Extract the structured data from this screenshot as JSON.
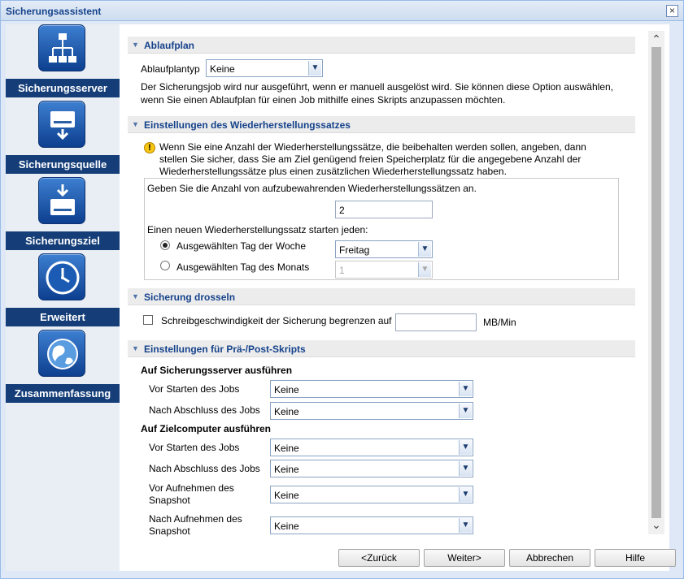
{
  "window": {
    "title": "Sicherungsassistent"
  },
  "nav": [
    {
      "label": "Sicherungsserver",
      "icon": "network-server-icon"
    },
    {
      "label": "Sicherungsquelle",
      "icon": "drive-download-icon"
    },
    {
      "label": "Sicherungsziel",
      "icon": "drive-target-icon"
    },
    {
      "label": "Erweitert",
      "icon": "clock-icon"
    },
    {
      "label": "Zusammenfassung",
      "icon": "globe-icon"
    }
  ],
  "schedule": {
    "header": "Ablaufplan",
    "type_label": "Ablaufplantyp",
    "type_value": "Keine",
    "desc1": "Der Sicherungsjob wird nur ausgeführt, wenn er manuell ausgelöst wird. Sie können diese Option auswählen,",
    "desc2": "wenn Sie einen Ablaufplan für einen Job mithilfe eines Skripts anzupassen möchten."
  },
  "retention": {
    "header": "Einstellungen des Wiederherstellungssatzes",
    "warn1": "Wenn Sie eine Anzahl der Wiederherstellungssätze, die beibehalten werden sollen, angeben, dann",
    "warn2": "stellen Sie sicher, dass Sie am Ziel genügend freien Speicherplatz für die angegebene Anzahl der",
    "warn3": "Wiederherstellungssätze plus einen zusätzlichen Wiederherstellungssatz haben.",
    "count_label": "Geben Sie die Anzahl von aufzubewahrenden Wiederherstellungssätzen an.",
    "count_value": "2",
    "start_label": "Einen neuen Wiederherstellungssatz starten jeden:",
    "weekday_label": "Ausgewählten Tag der Woche",
    "weekday_value": "Freitag",
    "monthday_label": "Ausgewählten Tag des Monats",
    "monthday_value": "1"
  },
  "throttle": {
    "header": "Sicherung drosseln",
    "label": "Schreibgeschwindigkeit der Sicherung begrenzen auf",
    "value": "",
    "unit": "MB/Min"
  },
  "scripts": {
    "header": "Einstellungen für Prä-/Post-Skripts",
    "server_title": "Auf Sicherungsserver ausführen",
    "server_before_label": "Vor Starten des Jobs",
    "server_before_value": "Keine",
    "server_after_label": "Nach Abschluss des Jobs",
    "server_after_value": "Keine",
    "target_title": "Auf Zielcomputer ausführen",
    "target_before_label": "Vor Starten des Jobs",
    "target_before_value": "Keine",
    "target_after_label": "Nach Abschluss des Jobs",
    "target_after_value": "Keine",
    "snap_before_label1": "Vor Aufnehmen des",
    "snap_before_label2": "Snapshot",
    "snap_before_value": "Keine",
    "snap_after_label1": "Nach Aufnehmen des",
    "snap_after_label2": "Snapshot",
    "snap_after_value": "Keine"
  },
  "buttons": {
    "back": "<Zurück",
    "next": "Weiter>",
    "cancel": "Abbrechen",
    "help": "Hilfe"
  }
}
